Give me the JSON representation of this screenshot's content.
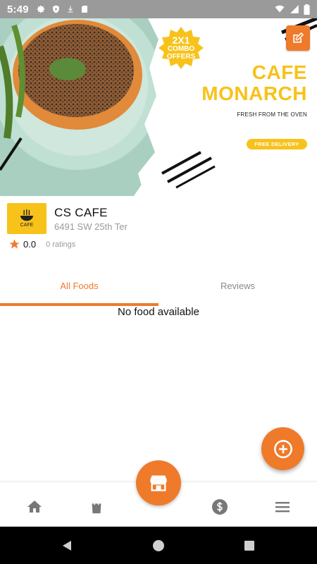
{
  "status_bar": {
    "time": "5:49",
    "left_icons": [
      "settings-icon",
      "play-protect-icon",
      "download-icon",
      "sd-card-icon"
    ],
    "right_icons": [
      "wifi-icon",
      "signal-icon",
      "battery-icon"
    ]
  },
  "banner": {
    "combo_line1": "2X1",
    "combo_line2": "COMBO",
    "combo_line3": "OFFERS",
    "title_line1": "CAFE",
    "title_line2": "MONARCH",
    "tagline": "FRESH FROM THE OVEN",
    "delivery_label": "FREE DELIVERY",
    "edit_icon": "edit-icon"
  },
  "restaurant": {
    "logo_text": "CAFE",
    "name": "CS CAFE",
    "address": "6491 SW 25th Ter",
    "rating": "0.0",
    "ratings_count": "0 ratings"
  },
  "tabs": [
    {
      "label": "All Foods",
      "active": true
    },
    {
      "label": "Reviews",
      "active": false
    }
  ],
  "content": {
    "empty_message": "No food available"
  },
  "bottom_nav": {
    "items": [
      "home-icon",
      "shopping-bag-icon",
      "store-icon",
      "dollar-icon",
      "menu-icon"
    ]
  },
  "colors": {
    "accent": "#ef7a2a",
    "brand_yellow": "#f7c21a",
    "muted_text": "#9a9a9a"
  }
}
